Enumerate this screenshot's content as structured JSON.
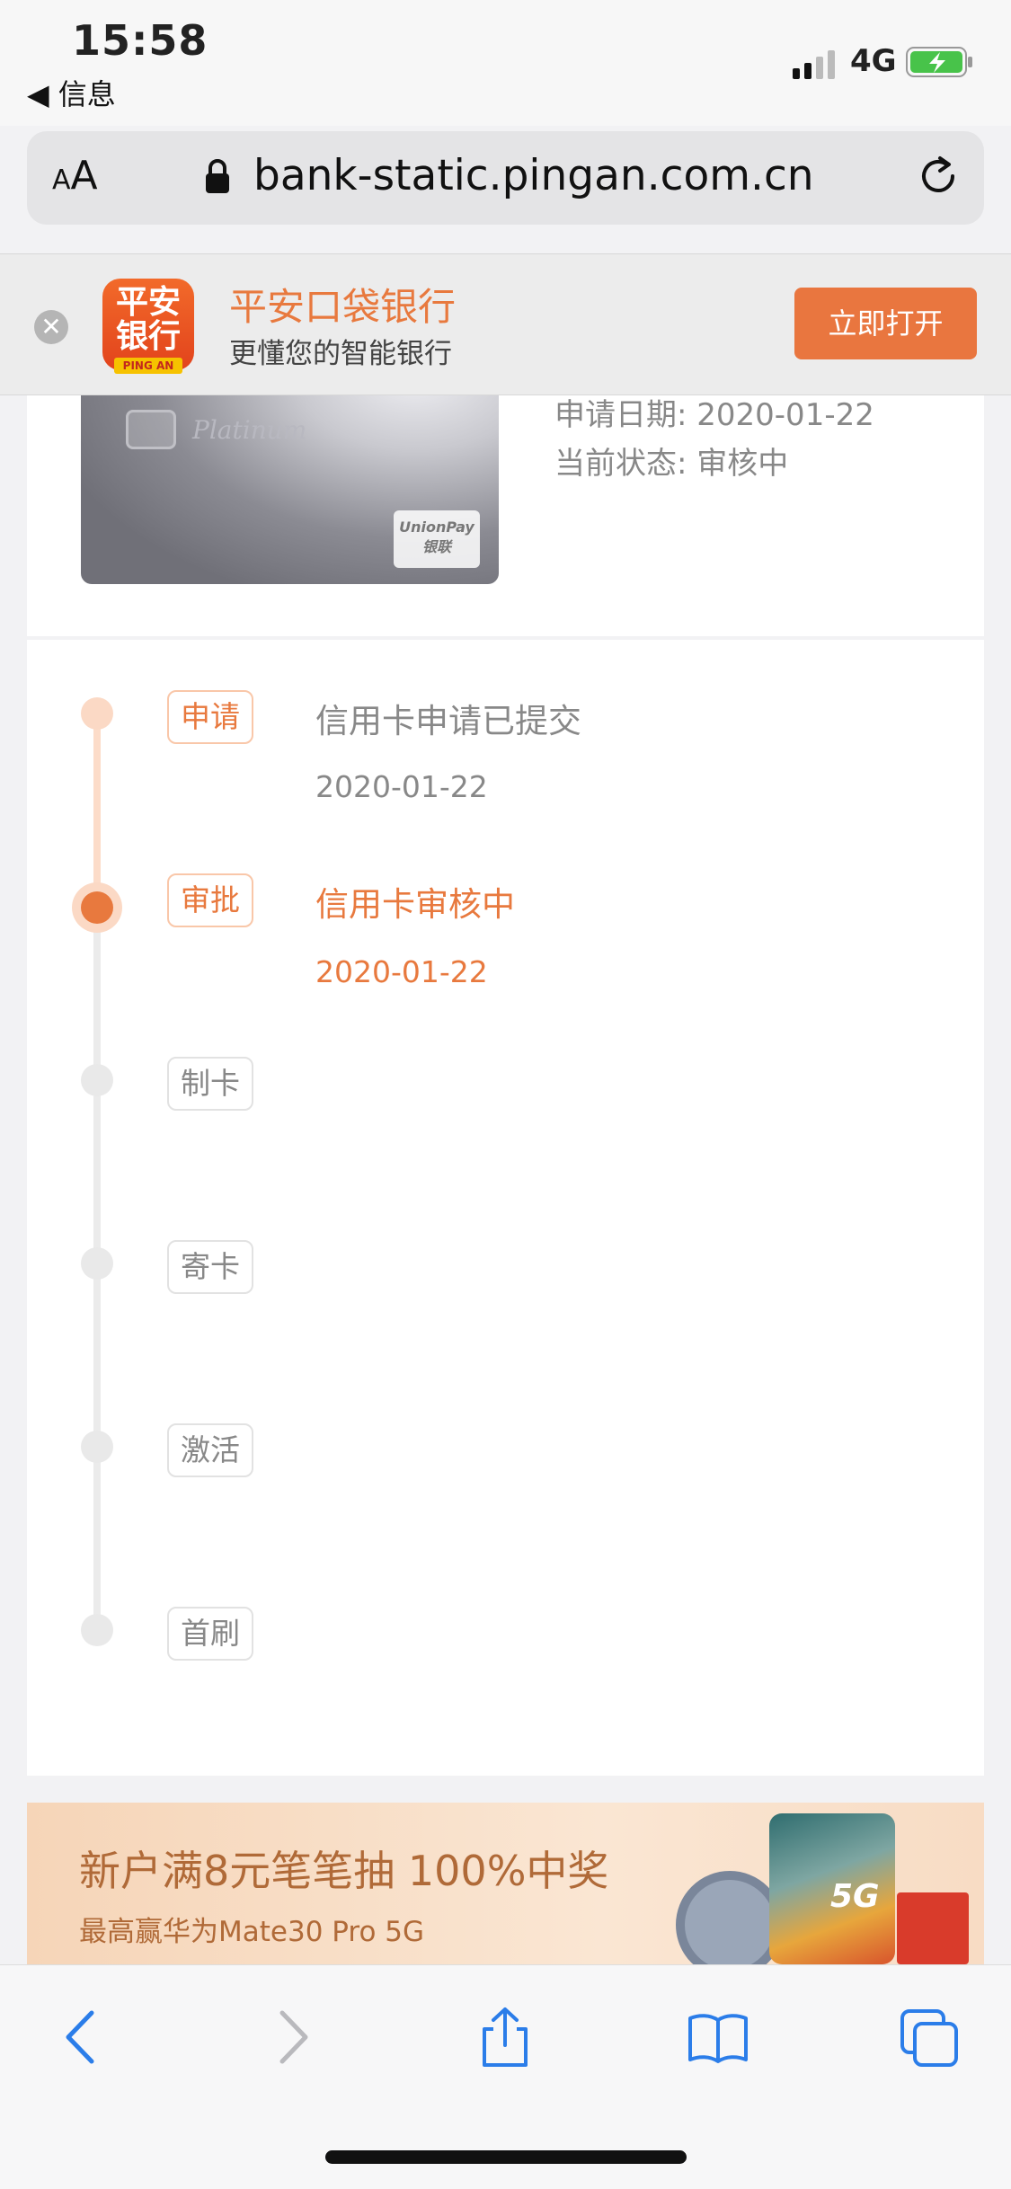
{
  "status_bar": {
    "time": "15:58",
    "back_app": "◀ 信息",
    "network": "4G",
    "icons": [
      "signal-icon",
      "battery-charging-icon"
    ]
  },
  "browser": {
    "text_size_label_small": "A",
    "text_size_label_large": "A",
    "url": "bank-static.pingan.com.cn",
    "icons": [
      "lock-icon",
      "reload-icon"
    ]
  },
  "app_banner": {
    "logo_text_line1": "平安",
    "logo_text_line2": "银行",
    "logo_badge": "PING AN",
    "name": "平安口袋银行",
    "slogan": "更懂您的智能银行",
    "open_button": "立即打开",
    "close_glyph": "✕"
  },
  "card": {
    "brand": "Platinum",
    "network_logo_line1": "UnionPay",
    "network_logo_line2": "银联",
    "apply_date": "申请日期: 2020-01-22",
    "current_status": "当前状态: 审核中"
  },
  "timeline": {
    "steps": [
      {
        "tag": "申请",
        "title": "信用卡申请已提交",
        "date": "2020-01-22"
      },
      {
        "tag": "审批",
        "title": "信用卡审核中",
        "date": "2020-01-22"
      },
      {
        "tag": "制卡",
        "title": "",
        "date": ""
      },
      {
        "tag": "寄卡",
        "title": "",
        "date": ""
      },
      {
        "tag": "激活",
        "title": "",
        "date": ""
      },
      {
        "tag": "首刷",
        "title": "",
        "date": ""
      }
    ],
    "current_step": 2,
    "accent_color": "#e8793e"
  },
  "promo": {
    "title": "新户满8元笔笔抽 100%中奖",
    "subtitle": "最高赢华为Mate30 Pro 5G",
    "badge": "5G"
  },
  "toolbar": {
    "icons": [
      "back-icon",
      "forward-icon",
      "share-icon",
      "bookmarks-icon",
      "tabs-icon"
    ]
  }
}
